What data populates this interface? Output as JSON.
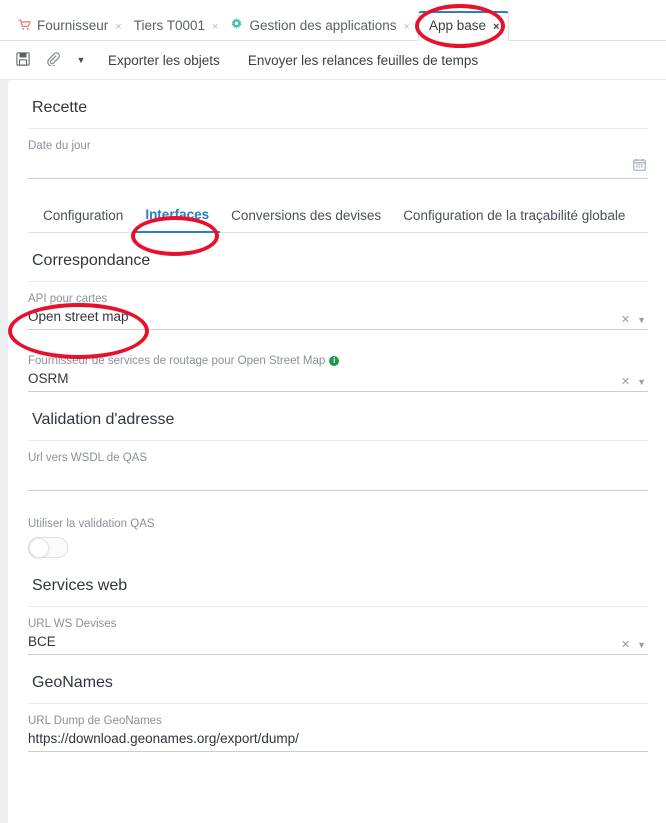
{
  "window_tabs": [
    {
      "label": "Fournisseur",
      "icon": "shopping-cart-icon",
      "icon_glyph": "Ὥ2",
      "close": "×",
      "active": false
    },
    {
      "label": "Tiers T0001",
      "icon": "",
      "close": "×",
      "active": false
    },
    {
      "label": "Gestion des applications",
      "icon": "gear-icon",
      "close": "×",
      "active": false
    },
    {
      "label": "App base",
      "icon": "",
      "close": "×",
      "active": true
    }
  ],
  "toolbar": {
    "save_icon": "save-icon",
    "attach_icon": "paperclip-icon",
    "dropdown_icon": "chevron-down-icon",
    "export_label": "Exporter les objets",
    "reminders_label": "Envoyer les relances feuilles de temps"
  },
  "recette": {
    "title": "Recette",
    "date_field": {
      "label": "Date du jour",
      "value": "",
      "icon": "calendar-icon"
    }
  },
  "subtabs": [
    {
      "label": "Configuration",
      "active": false
    },
    {
      "label": "Interfaces",
      "active": true
    },
    {
      "label": "Conversions des devises",
      "active": false
    },
    {
      "label": "Configuration de la traçabilité globale",
      "active": false
    }
  ],
  "correspondance": {
    "title": "Correspondance",
    "api_cartes": {
      "label": "API pour cartes",
      "value": "Open street map",
      "clear_icon": "clear-icon",
      "caret_icon": "chevron-down-icon"
    },
    "routing": {
      "label": "Fournisseur de services de routage pour Open Street Map",
      "info_icon": "info-icon",
      "value": "OSRM",
      "clear_icon": "clear-icon",
      "caret_icon": "chevron-down-icon"
    }
  },
  "validation_adresse": {
    "title": "Validation d'adresse",
    "wsdl": {
      "label": "Url vers WSDL de QAS",
      "value": ""
    },
    "qas_toggle": {
      "label": "Utiliser la validation QAS",
      "state": "off"
    }
  },
  "services_web": {
    "title": "Services web",
    "url_ws_devises": {
      "label": "URL WS Devises",
      "value": "BCE",
      "clear_icon": "clear-icon",
      "caret_icon": "chevron-down-icon"
    }
  },
  "geonames": {
    "title": "GeoNames",
    "url_dump": {
      "label": "URL Dump de GeoNames",
      "value": "https://download.geonames.org/export/dump/"
    }
  },
  "colors": {
    "accent_blue": "#2b7ec1",
    "annotation_red": "#e8112d",
    "cart_icon": "#e8847a",
    "gear_icon": "#3fc1b0",
    "info_green": "#1a9a4d"
  }
}
